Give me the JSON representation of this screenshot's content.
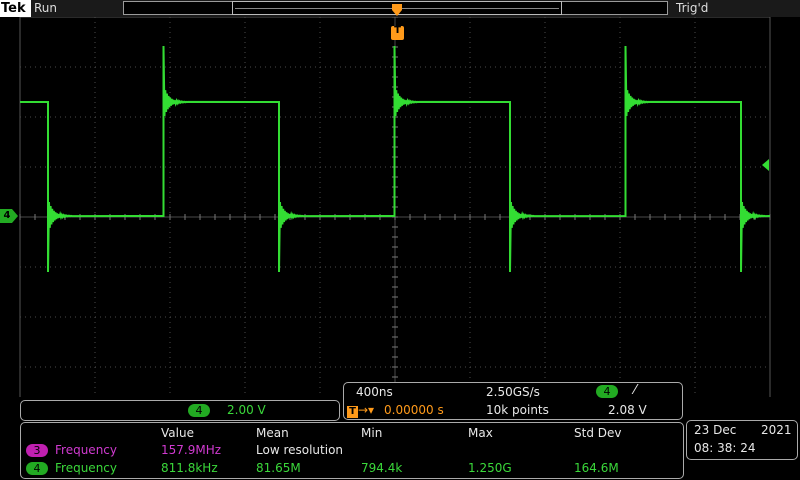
{
  "header": {
    "brand": "Tek",
    "run_state": "Run",
    "trigger_state": "Trig'd"
  },
  "trigger_marker": {
    "label": "T"
  },
  "channel_marker": {
    "label": "4"
  },
  "colors": {
    "trace": "#33dd33",
    "accent": "#ff9a1a",
    "grid": "#555555"
  },
  "vertical": {
    "channel": "4",
    "scale": "2.00 V"
  },
  "horizontal": {
    "time_div": "400ns",
    "sample_rate": "2.50GS/s",
    "trig_channel": "4",
    "trig_slope_icon": "rising-edge-icon",
    "trig_slope_glyph": "⁄",
    "trig_position": "0.00000 s",
    "record_length": "10k points",
    "trig_level": "2.08 V"
  },
  "measurements": {
    "headers": [
      "Value",
      "Mean",
      "Min",
      "Max",
      "Std Dev"
    ],
    "rows": [
      {
        "channel": "3",
        "name": "Frequency",
        "value": "157.9MHz",
        "mean": "Low resolution",
        "min": "",
        "max": "",
        "std": ""
      },
      {
        "channel": "4",
        "name": "Frequency",
        "value": "811.8kHz",
        "mean": "81.65M",
        "min": "794.4k",
        "max": "1.250G",
        "std": "164.6M"
      }
    ]
  },
  "datetime": {
    "date": "23 Dec",
    "year": "2021",
    "time": "08: 38: 24"
  }
}
